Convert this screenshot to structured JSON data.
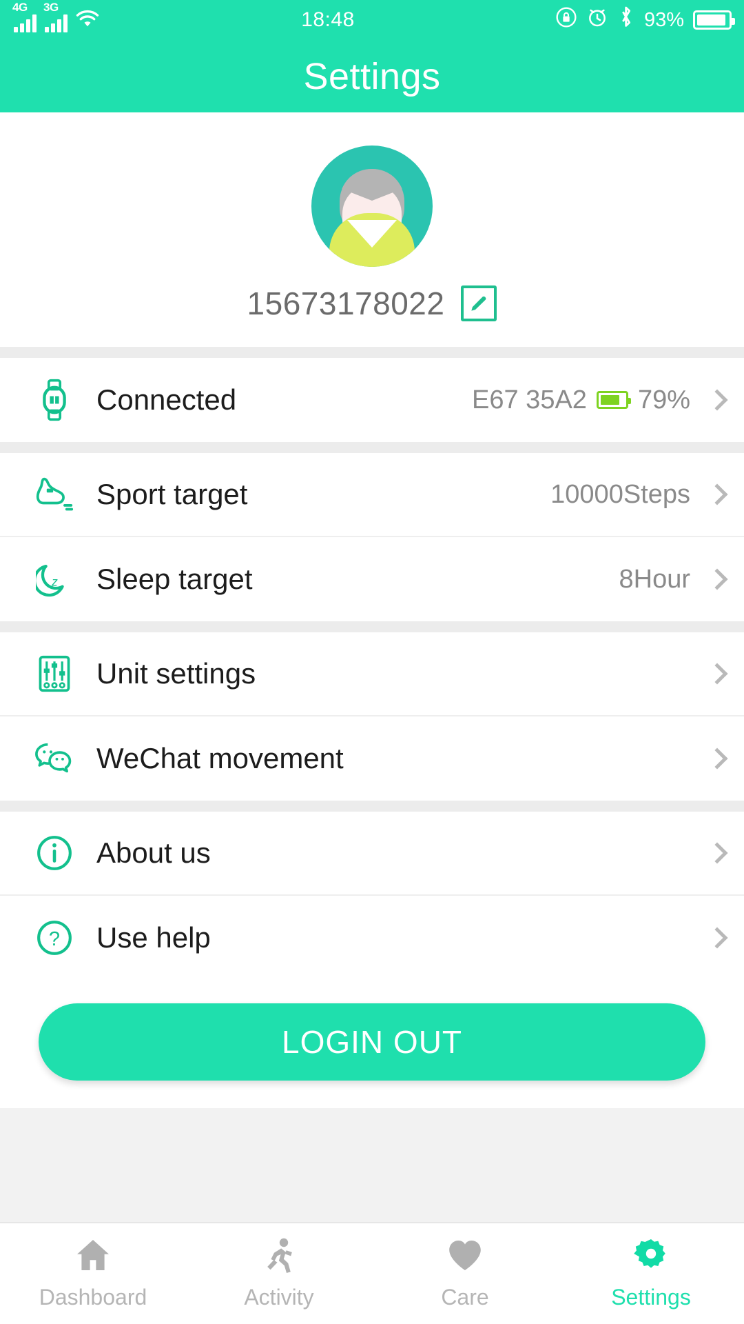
{
  "statusbar": {
    "network_primary": "4G",
    "network_secondary": "3G",
    "wifi_icon": "wifi-icon",
    "time": "18:48",
    "rotation_lock_icon": "rotation-lock-icon",
    "alarm_icon": "alarm-clock-icon",
    "bluetooth_icon": "bluetooth-icon",
    "battery_percent": "93%",
    "battery_level": 93
  },
  "header": {
    "title": "Settings"
  },
  "profile": {
    "avatar_icon": "user-avatar",
    "username": "15673178022",
    "edit_icon": "pencil-edit-icon"
  },
  "settings_groups": [
    {
      "rows": [
        {
          "icon": "smart-band-icon",
          "label": "Connected",
          "device_id": "E67 35A2",
          "battery_icon": "device-battery-icon",
          "battery_level": 79,
          "value": "79%",
          "chevron": "chevron-right-icon"
        }
      ]
    },
    {
      "rows": [
        {
          "icon": "running-shoe-icon",
          "label": "Sport target",
          "value": "10000Steps",
          "chevron": "chevron-right-icon"
        },
        {
          "icon": "moon-sleep-icon",
          "label": "Sleep target",
          "value": "8Hour",
          "chevron": "chevron-right-icon"
        }
      ]
    },
    {
      "rows": [
        {
          "icon": "sliders-unit-icon",
          "label": "Unit settings",
          "value": "",
          "chevron": "chevron-right-icon"
        },
        {
          "icon": "wechat-icon",
          "label": "WeChat movement",
          "value": "",
          "chevron": "chevron-right-icon"
        }
      ]
    },
    {
      "rows": [
        {
          "icon": "info-circle-icon",
          "label": "About us",
          "value": "",
          "chevron": "chevron-right-icon"
        },
        {
          "icon": "question-circle-icon",
          "label": "Use help",
          "value": "",
          "chevron": "chevron-right-icon"
        }
      ]
    }
  ],
  "logout": {
    "label": "LOGIN OUT"
  },
  "tabbar": {
    "tabs": [
      {
        "label": "Dashboard",
        "icon": "home-icon",
        "active": false
      },
      {
        "label": "Activity",
        "icon": "running-person-icon",
        "active": false
      },
      {
        "label": "Care",
        "icon": "heart-icon",
        "active": false
      },
      {
        "label": "Settings",
        "icon": "gear-icon",
        "active": true
      }
    ]
  },
  "colors": {
    "brand": "#1fe0ae",
    "brand_dark": "#1fbf8f",
    "avatar_bg": "#2bc4b0",
    "shirt": "#ddec5c",
    "device_battery": "#7ed321",
    "inactive_tab": "#b5b5b5",
    "value_text": "#8a8a8a"
  }
}
